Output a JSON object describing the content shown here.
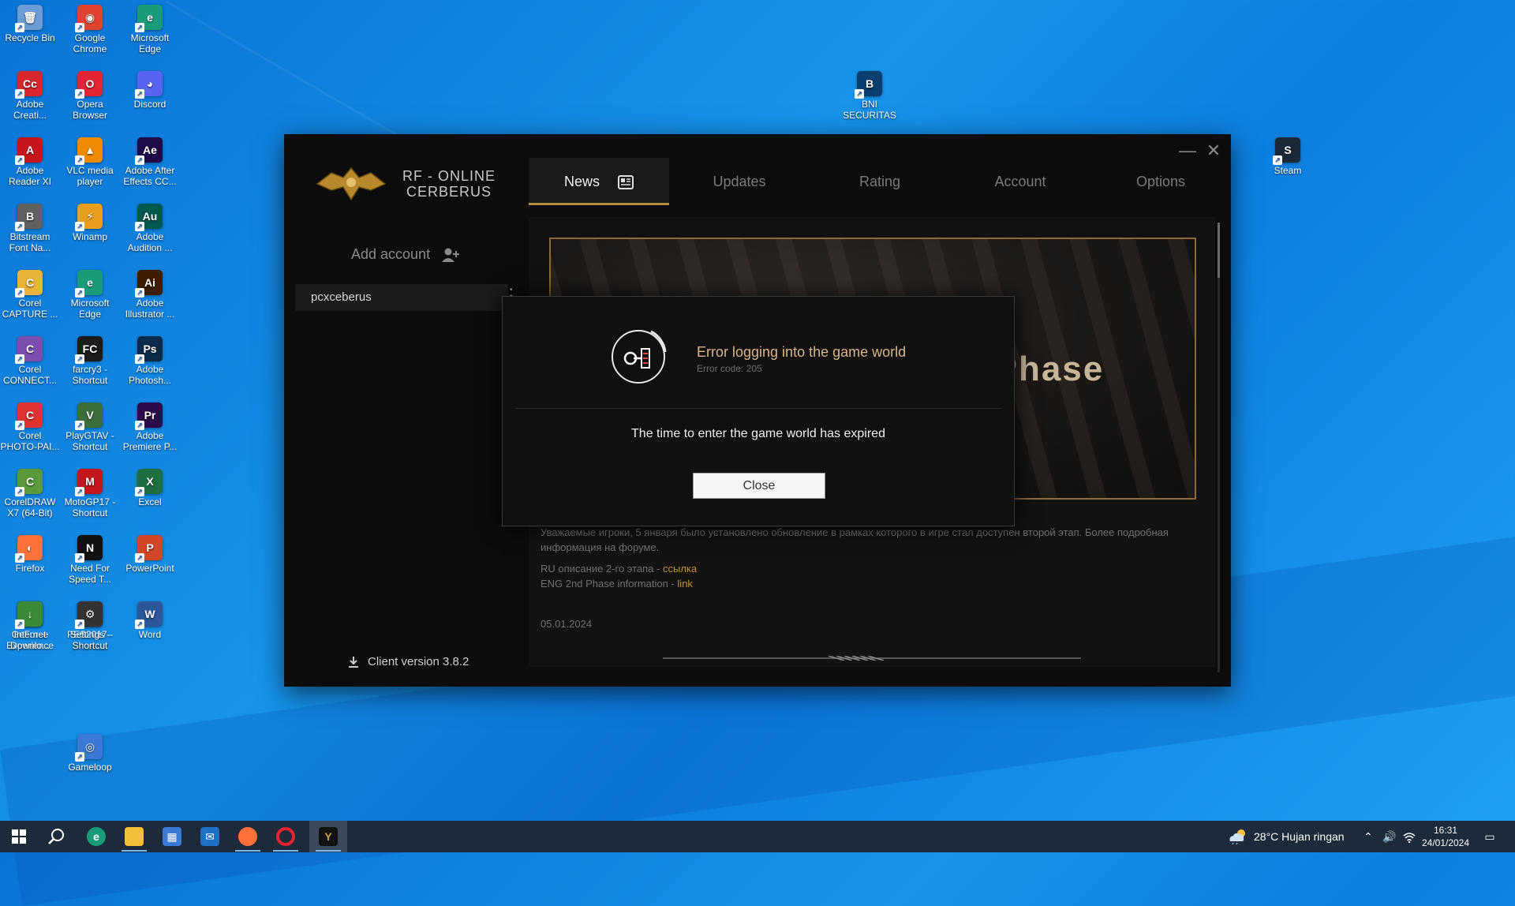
{
  "desktop": {
    "icons": [
      {
        "label": "Recycle Bin",
        "glyph": "🗑",
        "color": "#6b9cd6"
      },
      {
        "label": "Google Chrome",
        "glyph": "◉",
        "color": "#e0442f"
      },
      {
        "label": "Microsoft Edge",
        "glyph": "e",
        "color": "#1a9c7a"
      },
      {
        "label": "Adobe Creati...",
        "glyph": "Cc",
        "color": "#d8262e"
      },
      {
        "label": "Opera Browser",
        "glyph": "O",
        "color": "#e32432"
      },
      {
        "label": "Discord",
        "glyph": "◕",
        "color": "#5865f2"
      },
      {
        "label": "Adobe Reader XI",
        "glyph": "A",
        "color": "#c4161c"
      },
      {
        "label": "VLC media player",
        "glyph": "▲",
        "color": "#f08a00"
      },
      {
        "label": "Adobe After Effects CC...",
        "glyph": "Ae",
        "color": "#1f0a4a"
      },
      {
        "label": "Bitstream Font Na...",
        "glyph": "B",
        "color": "#606060"
      },
      {
        "label": "Winamp",
        "glyph": "⚡",
        "color": "#e89d1c"
      },
      {
        "label": "Adobe Audition ...",
        "glyph": "Au",
        "color": "#00594f"
      },
      {
        "label": "Corel CAPTURE ...",
        "glyph": "C",
        "color": "#e8b43a"
      },
      {
        "label": "Microsoft Edge",
        "glyph": "e",
        "color": "#1a9c7a"
      },
      {
        "label": "Adobe Illustrator ...",
        "glyph": "Ai",
        "color": "#3d1c00"
      },
      {
        "label": "Corel CONNECT...",
        "glyph": "C",
        "color": "#7a4fb0"
      },
      {
        "label": "farcry3 - Shortcut",
        "glyph": "FC",
        "color": "#1b1b1b"
      },
      {
        "label": "Adobe Photosh...",
        "glyph": "Ps",
        "color": "#0a2a4a"
      },
      {
        "label": "Corel PHOTO-PAI...",
        "glyph": "C",
        "color": "#d33"
      },
      {
        "label": "PlayGTAV - Shortcut",
        "glyph": "V",
        "color": "#3c6e3c"
      },
      {
        "label": "Adobe Premiere P...",
        "glyph": "Pr",
        "color": "#2a0a4a"
      },
      {
        "label": "CorelDRAW X7 (64-Bit)",
        "glyph": "C",
        "color": "#5a9a3a"
      },
      {
        "label": "MotoGP17 - Shortcut",
        "glyph": "M",
        "color": "#c4161c"
      },
      {
        "label": "Excel",
        "glyph": "X",
        "color": "#1d6f42"
      },
      {
        "label": "Firefox",
        "glyph": "◐",
        "color": "#ff7139"
      },
      {
        "label": "Need For Speed T...",
        "glyph": "N",
        "color": "#111"
      },
      {
        "label": "PowerPoint",
        "glyph": "P",
        "color": "#d24726"
      },
      {
        "label": "GeForce Experience",
        "glyph": "G",
        "color": "#2a2a2a"
      },
      {
        "label": "PES2017 - Shortcut",
        "glyph": "P",
        "color": "#3a3a7a"
      },
      {
        "label": "Word",
        "glyph": "W",
        "color": "#2b579a"
      },
      {
        "label": "Internet Downlo...",
        "glyph": "↓",
        "color": "#3a8a3a"
      },
      {
        "label": "Settings - Shortcut",
        "glyph": "⚙",
        "color": "#333"
      },
      {
        "label": "Gameloop",
        "glyph": "◎",
        "color": "#3a7ad6"
      },
      {
        "label": "BNI SECURITAS",
        "glyph": "B",
        "color": "#0b3e6e"
      },
      {
        "label": "Steam",
        "glyph": "S",
        "color": "#1b2838"
      }
    ]
  },
  "launcher": {
    "logo_text_line1": "RF - ONLINE",
    "logo_text_line2": "CERBERUS",
    "add_account": "Add account",
    "account_name": "pcxceberus",
    "client_version": "Client version 3.8.2",
    "tabs": [
      "News",
      "Updates",
      "Rating",
      "Account",
      "Options"
    ],
    "banner_title": "Второй этап | 2nd Phase",
    "news": {
      "paragraph": "Уважаемые игроки, 5 января было установлено обновление в рамках которого в игре стал доступен второй этап. Более подробная информация на форуме.",
      "ru_label": "RU описание 2-го этапа - ",
      "ru_link": "ссылка",
      "eng_label": "ENG 2nd Phase information - ",
      "eng_link": "link",
      "date": "05.01.2024"
    }
  },
  "dialog": {
    "title": "Error logging into the game world",
    "code": "Error code: 205",
    "message": "The time to enter the game world has expired",
    "close_label": "Close"
  },
  "taskbar": {
    "weather": "28°C  Hujan ringan",
    "time": "16:31",
    "date": "24/01/2024"
  }
}
